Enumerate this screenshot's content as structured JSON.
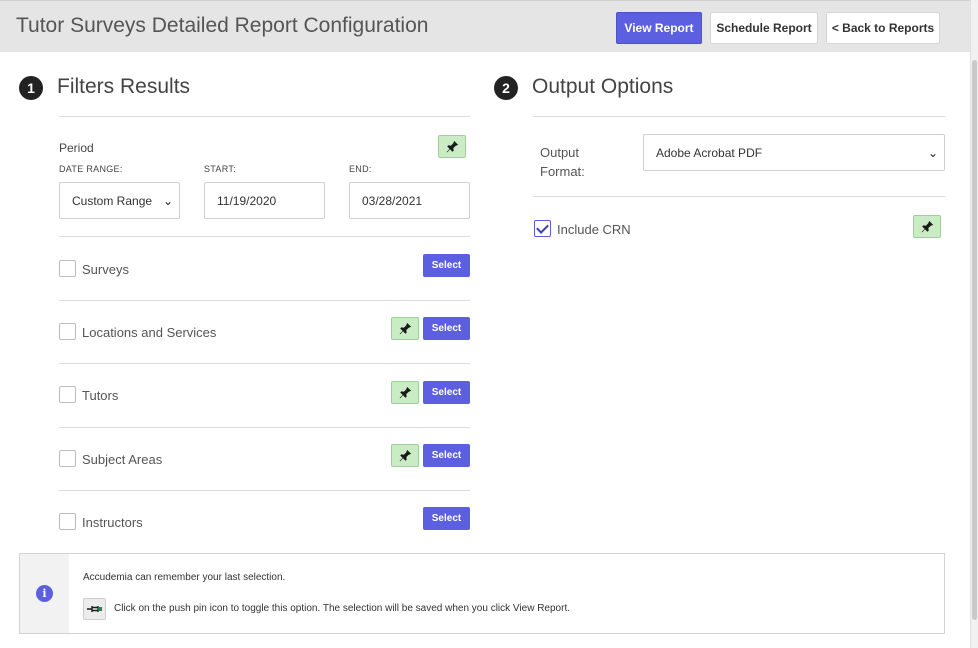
{
  "header": {
    "title": "Tutor Surveys Detailed Report Configuration",
    "view_report": "View Report",
    "schedule_report": "Schedule Report",
    "back_to_reports": "< Back to Reports"
  },
  "filters": {
    "step": "1",
    "title": "Filters Results",
    "period": {
      "label": "Period",
      "date_range_label": "DATE RANGE:",
      "date_range_value": "Custom Range",
      "start_label": "START:",
      "start_value": "11/19/2020",
      "end_label": "END:",
      "end_value": "03/28/2021"
    },
    "items": [
      {
        "label": "Surveys",
        "checked": false,
        "pin": false,
        "select_label": "Select"
      },
      {
        "label": "Locations and Services",
        "checked": false,
        "pin": true,
        "select_label": "Select"
      },
      {
        "label": "Tutors",
        "checked": false,
        "pin": true,
        "select_label": "Select"
      },
      {
        "label": "Subject Areas",
        "checked": false,
        "pin": true,
        "select_label": "Select"
      },
      {
        "label": "Instructors",
        "checked": false,
        "pin": false,
        "select_label": "Select"
      }
    ]
  },
  "output": {
    "step": "2",
    "title": "Output Options",
    "format_label_line1": "Output",
    "format_label_line2": "Format:",
    "format_value": "Adobe Acrobat PDF",
    "include_crn_label": "Include CRN",
    "include_crn_checked": true
  },
  "info": {
    "line1": "Accudemia can remember your last selection.",
    "line2": "Click on the push pin icon to toggle this option. The selection will be saved when you click View Report."
  },
  "colors": {
    "accent": "#5b5fe0",
    "pin_active": "#c9ecc4",
    "header_bg": "#e5e5e5"
  }
}
